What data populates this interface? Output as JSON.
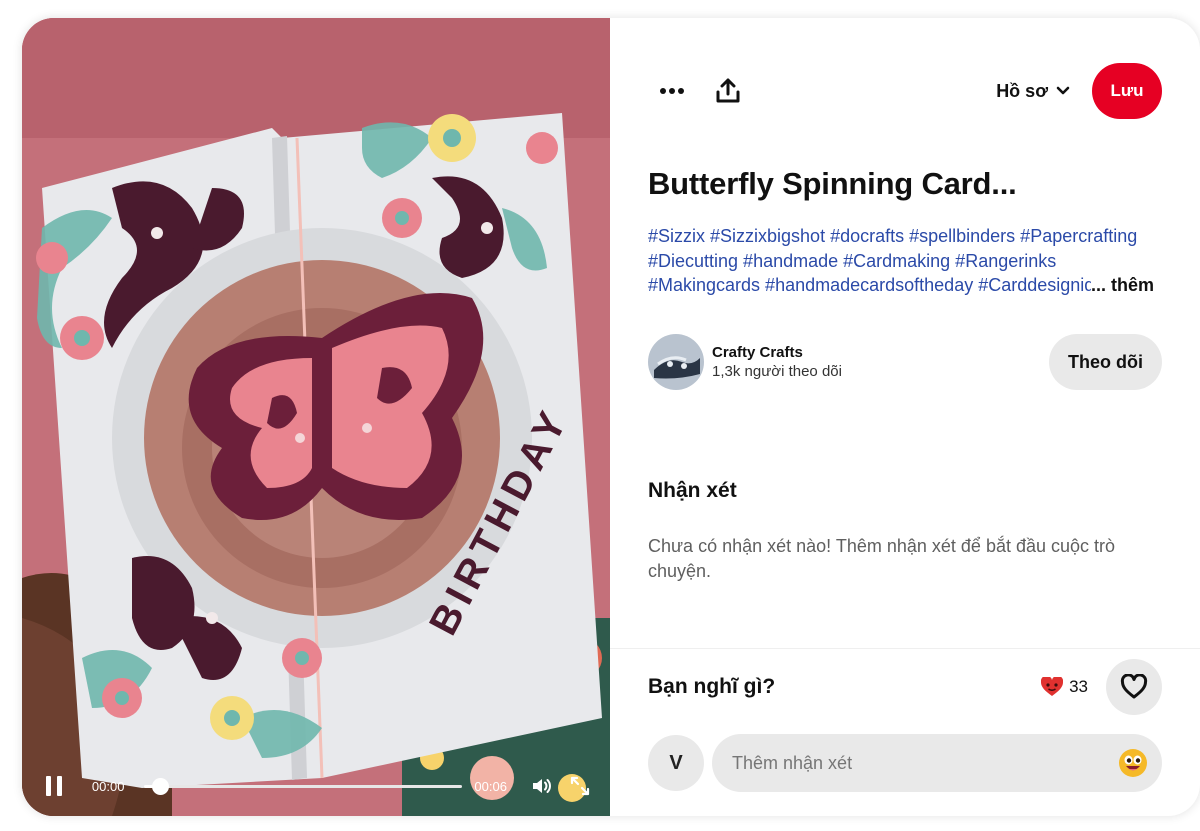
{
  "media": {
    "card_text": "BIRTHDAY",
    "time_current": "00:00",
    "time_total": "00:06",
    "progress": 0.05
  },
  "topbar": {
    "more_icon": "more-horizontal-icon",
    "share_icon": "share-upload-icon",
    "profile_label": "Hồ sơ",
    "save_label": "Lưu"
  },
  "pin": {
    "title": "Butterfly Spinning Card...",
    "description_lines": [
      "#Sizzix #Sizzixbigshot #docrafts #spellbinders #Papercrafting",
      "#Diecutting #handmade #Cardmaking #Rangerinks",
      "#Makingcards #handmadecardsoftheday #Carddesignideas"
    ],
    "more_label": "... thêm"
  },
  "creator": {
    "name": "Crafty Crafts",
    "followers": "1,3k người theo dõi",
    "follow_label": "Theo dõi"
  },
  "comments": {
    "title": "Nhận xét",
    "empty_text": "Chưa có nhận xét nào! Thêm nhận xét để bắt đầu cuộc trò chuyện."
  },
  "reactions": {
    "question": "Bạn nghĩ gì?",
    "count": "33",
    "reaction_icon": "heart-eyes-emoji-icon",
    "heart_icon": "heart-outline-icon"
  },
  "composer": {
    "user_initial": "V",
    "placeholder": "Thêm nhận xét",
    "emoji_icon": "smiley-emoji-icon"
  },
  "colors": {
    "save": "#e60023",
    "hashtag": "#2b4aa8",
    "pill": "#e9e9e9"
  }
}
